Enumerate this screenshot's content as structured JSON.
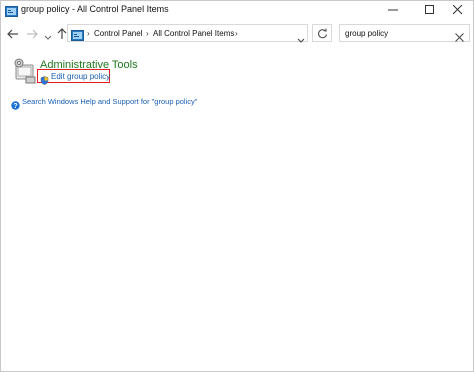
{
  "window": {
    "title": "group policy - All Control Panel Items",
    "icon": "control-panel-icon"
  },
  "titlebar_buttons": [
    "minimize-icon",
    "maximize-icon",
    "close-icon"
  ],
  "navigation": {
    "back_icon": "arrow-left-icon",
    "forward_icon": "arrow-right-icon",
    "recent_icon": "chevron-down-icon",
    "up_icon": "arrow-up-icon"
  },
  "address_bar": {
    "icon": "control-panel-icon",
    "breadcrumbs": [
      "Control Panel",
      "All Control Panel Items"
    ],
    "separator": "›"
  },
  "refresh_icon": "refresh-icon",
  "search": {
    "value": "group policy",
    "clear_icon": "close-icon"
  },
  "results": {
    "category": {
      "title": "Administrative Tools",
      "icon": "administrative-tools-icon",
      "tasks": [
        {
          "label": "Edit group policy",
          "icon": "uac-shield-icon",
          "highlighted": true
        }
      ]
    },
    "help_link": {
      "label": "Search Windows Help and Support for \"group policy\"",
      "icon": "help-icon"
    }
  },
  "colors": {
    "category_title": "#1f7a1f",
    "link": "#1a5fb4",
    "highlight_border": "#e02020"
  }
}
